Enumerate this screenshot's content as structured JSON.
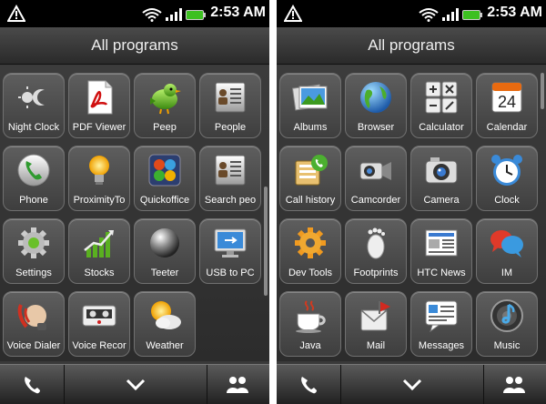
{
  "left": {
    "status": {
      "time": "2:53 AM"
    },
    "title": "All programs",
    "apps": [
      {
        "label": "Night Clock",
        "icon": "night-clock-icon"
      },
      {
        "label": "PDF Viewer",
        "icon": "pdf-viewer-icon"
      },
      {
        "label": "Peep",
        "icon": "peep-bird-icon"
      },
      {
        "label": "People",
        "icon": "people-contacts-icon"
      },
      {
        "label": "Phone",
        "icon": "phone-handset-icon"
      },
      {
        "label": "ProximityTo",
        "icon": "lightbulb-icon"
      },
      {
        "label": "Quickoffice",
        "icon": "quickoffice-icon"
      },
      {
        "label": "Search peo",
        "icon": "search-people-icon"
      },
      {
        "label": "Settings",
        "icon": "settings-gear-icon"
      },
      {
        "label": "Stocks",
        "icon": "stocks-chart-icon"
      },
      {
        "label": "Teeter",
        "icon": "teeter-ball-icon"
      },
      {
        "label": "USB to PC",
        "icon": "usb-monitor-icon"
      },
      {
        "label": "Voice Dialer",
        "icon": "voice-dialer-icon"
      },
      {
        "label": "Voice Recor",
        "icon": "voice-recorder-icon"
      },
      {
        "label": "Weather",
        "icon": "weather-sun-cloud-icon"
      }
    ]
  },
  "right": {
    "status": {
      "time": "2:53 AM"
    },
    "title": "All programs",
    "apps": [
      {
        "label": "Albums",
        "icon": "albums-photo-icon"
      },
      {
        "label": "Browser",
        "icon": "browser-globe-icon"
      },
      {
        "label": "Calculator",
        "icon": "calculator-icon"
      },
      {
        "label": "Calendar",
        "icon": "calendar-icon",
        "day": "24"
      },
      {
        "label": "Call history",
        "icon": "call-history-icon"
      },
      {
        "label": "Camcorder",
        "icon": "camcorder-icon"
      },
      {
        "label": "Camera",
        "icon": "camera-icon"
      },
      {
        "label": "Clock",
        "icon": "alarm-clock-icon"
      },
      {
        "label": "Dev Tools",
        "icon": "dev-tools-gear-icon"
      },
      {
        "label": "Footprints",
        "icon": "footprints-icon"
      },
      {
        "label": "HTC News",
        "icon": "news-icon"
      },
      {
        "label": "IM",
        "icon": "im-chat-bubbles-icon"
      },
      {
        "label": "Java",
        "icon": "java-cup-icon"
      },
      {
        "label": "Mail",
        "icon": "mail-icon"
      },
      {
        "label": "Messages",
        "icon": "messages-icon"
      },
      {
        "label": "Music",
        "icon": "music-speaker-icon"
      }
    ]
  }
}
